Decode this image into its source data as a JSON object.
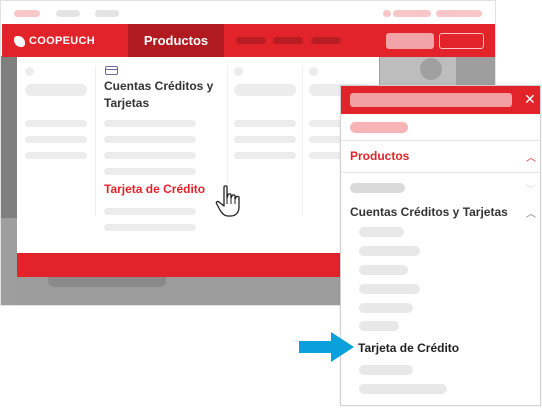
{
  "desktop": {
    "brand": "COOPEUCH",
    "nav_tab": "Productos",
    "menu_category": "Cuentas Créditos y Tarjetas",
    "menu_link": "Tarjeta de Crédito"
  },
  "mobile": {
    "section": "Productos",
    "category": "Cuentas Créditos y Tarjetas",
    "highlighted_item": "Tarjeta de Crédito",
    "close_glyph": "✕"
  },
  "icons": {
    "logo": "coopeuch-logo-icon",
    "card": "credit-card-icon",
    "cursor": "hand-pointer-icon",
    "arrow": "arrow-right-icon"
  },
  "colors": {
    "brand_red": "#e2232a",
    "active_tab": "#b01a20",
    "arrow_blue": "#0aa0dc"
  }
}
